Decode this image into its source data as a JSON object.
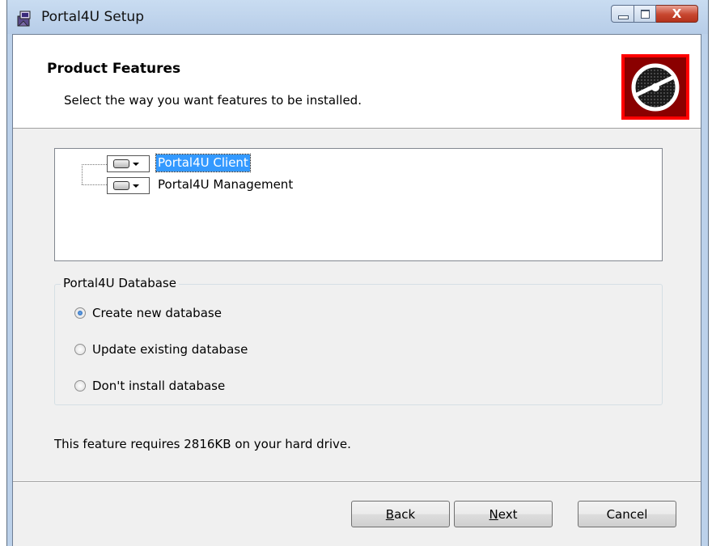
{
  "window": {
    "title": "Portal4U Setup",
    "icon": "installer-icon",
    "caption_buttons": {
      "minimize": "minimize-icon",
      "maximize": "maximize-icon",
      "close_label": "X"
    }
  },
  "banner": {
    "title": "Product Features",
    "subtitle": "Select the way you want features to be installed.",
    "logo": "disc-logo",
    "logo_color": "#ff0000"
  },
  "features": {
    "items": [
      {
        "label": "Portal4U Client",
        "selected": true
      },
      {
        "label": "Portal4U Management",
        "selected": false
      }
    ],
    "selection_color": "#3399ff"
  },
  "database_group": {
    "title": "Portal4U Database",
    "options": [
      {
        "label": "Create new database",
        "checked": true
      },
      {
        "label": "Update existing database",
        "checked": false
      },
      {
        "label": "Don't install database",
        "checked": false
      }
    ]
  },
  "status": {
    "space_text": "This feature requires 2816KB on your hard drive."
  },
  "buttons": {
    "back_mnemonic": "B",
    "back_rest": "ack",
    "next_mnemonic": "N",
    "next_rest": "ext",
    "cancel": "Cancel"
  }
}
